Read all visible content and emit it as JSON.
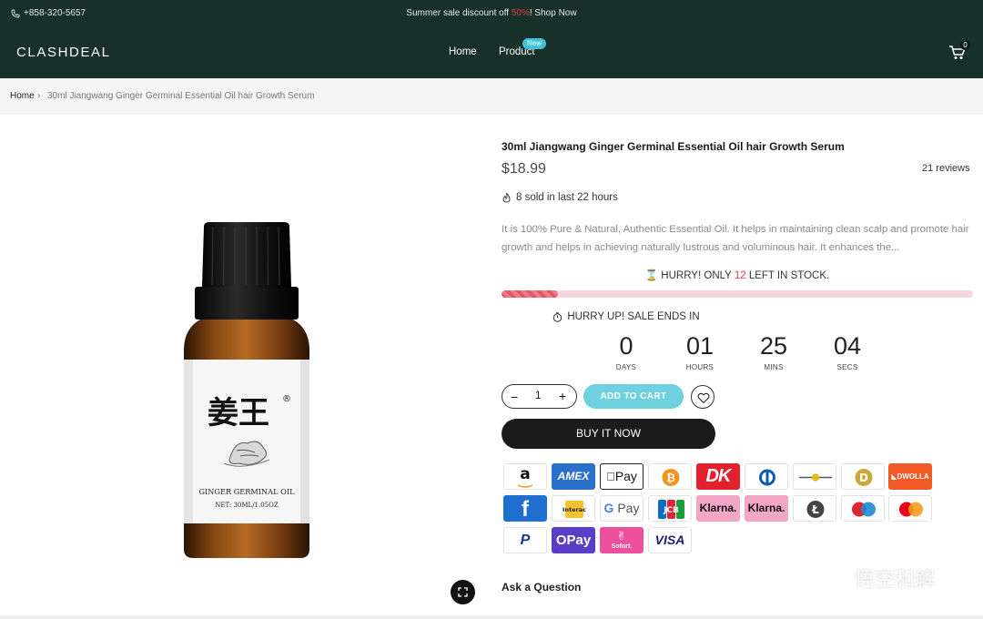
{
  "topbar": {
    "phone": "+858-320-5657",
    "promo_before": "Summer sale discount off ",
    "promo_pct": "50%",
    "promo_after": "! Shop Now"
  },
  "header": {
    "logo": "CLASHDEAL",
    "nav": {
      "home": "Home",
      "product": "Product",
      "product_badge": "New"
    },
    "cart_count": "0"
  },
  "breadcrumb": {
    "home": "Home",
    "separator": "›",
    "current": "30ml Jiangwang Ginger Germinal Essential Oil hair Growth Serum"
  },
  "product": {
    "title": "30ml Jiangwang Ginger Germinal Essential Oil hair Growth Serum",
    "price": "$18.99",
    "reviews": "21 reviews",
    "sold": "8 sold in last 22 hours",
    "description": "It is 100% Pure & Natural, Authentic Essential Oil. It helps in maintaining clean scalp and promote hair growth and helps in achieving naturally lustrous and voluminous hair. It enhances the...",
    "image_label": {
      "chinese": "姜王",
      "registered": "®",
      "name": "GINGER GERMINAL OIL",
      "net": "NET: 30ML/1.05OZ"
    }
  },
  "stock": {
    "prefix": "HURRY! ONLY ",
    "count": "12",
    "suffix": " LEFT IN STOCK.",
    "level_fraction": 0.12
  },
  "countdown": {
    "heading": "HURRY UP! SALE ENDS IN",
    "days": "0",
    "days_label": "DAYS",
    "hours": "01",
    "hours_label": "HOURS",
    "mins": "25",
    "mins_label": "MINS",
    "secs": "04",
    "secs_label": "SECS"
  },
  "purchase": {
    "minus": "−",
    "quantity": "1",
    "plus": "+",
    "add_to_cart": "ADD TO CART",
    "buy_now": "BUY IT NOW"
  },
  "payments": {
    "amazon": "a",
    "amex": "AMEX",
    "applepay": "Pay",
    "bitcoin": "₿",
    "dankort": "DK",
    "diners": "",
    "dogecoin": "D",
    "dwolla": "DWOLLA",
    "forbrugs": "f",
    "interac": "Interac",
    "gpay_g": "G",
    "gpay_pay": "Pay",
    "jcb": "JCB",
    "klarna": "Klarna.",
    "klarna2": "Klarna.",
    "litecoin": "Ł",
    "paypal": "P",
    "opay": "OPay",
    "sofort": "Sofort.",
    "visa": "VISA"
  },
  "ask_question": "Ask a Question",
  "watermark": "悟空和解",
  "colors": {
    "header_bg": "#17302a",
    "accent_red": "#e0413f",
    "badge_cyan": "#3fc1d8",
    "add_to_cart": "#6fd0e0",
    "stock_bar_bg": "#f8d4dc",
    "stock_fill": "#e55867"
  }
}
